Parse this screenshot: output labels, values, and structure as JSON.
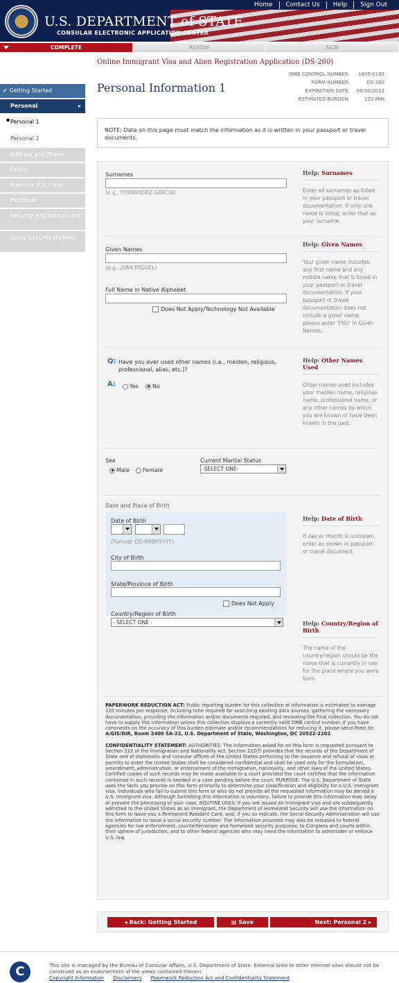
{
  "header": {
    "title": "U.S. DEPARTMENT of STATE",
    "subtitle": "CONSULAR ELECTRONIC APPLICATION CENTER",
    "nav": [
      "Home",
      "Contact Us",
      "Help",
      "Sign Out"
    ]
  },
  "progress": {
    "steps": [
      "COMPLETE",
      "REVIEW",
      "SIGN"
    ]
  },
  "page": {
    "form_title": "Online Immigrant Visa and Alien Registration Application (DS-260)",
    "title": "Personal Information 1"
  },
  "omb": {
    "control_label": "OMB CONTROL NUMBER:",
    "control": "1405-0185",
    "form_label": "FORM NUMBER:",
    "form": "DS-260",
    "exp_label": "EXPIRATION DATE:",
    "exp": "06/30/2012",
    "burden_label": "ESTIMATED BURDEN:",
    "burden": "120 MIN"
  },
  "sidebar": {
    "items": [
      "Getting Started",
      "Personal",
      "Personal 1",
      "Personal 2",
      "Address and Phone",
      "Family",
      "Previous U.S. Travel",
      "Petitioner",
      "Security and Background",
      "Social Security Number"
    ]
  },
  "note": "NOTE: Data on this page must match the information as it is written in your passport or travel documents.",
  "form": {
    "surnames_label": "Surnames",
    "surnames_hint": "(e.g., FERNANDEZ GARCIA)",
    "given_label": "Given Names",
    "given_hint": "(e.g., JUAN MIGUEL)",
    "native_label": "Full Name in Native Alphabet",
    "native_na": "Does Not Apply/Technology Not Available",
    "q_label": "Q:",
    "question": "Have you ever used other names (i.e., maiden, religious, professional, alias, etc.)?",
    "a_label": "A:",
    "yes": "Yes",
    "no": "No",
    "sex_label": "Sex",
    "male": "Male",
    "female": "Female",
    "marital_label": "Current Marital Status",
    "marital_value": "-SELECT ONE-",
    "dob_section": "Date and Place of Birth",
    "dob_label": "Date of Birth",
    "dob_hint": "(Format: DD-MMM-YYYY)",
    "city_label": "City of Birth",
    "state_label": "State/Province of Birth",
    "state_na": "Does Not Apply",
    "country_label": "Country/Region of Birth",
    "country_value": "- SELECT ONE -"
  },
  "help": {
    "surnames_title": "Surnames",
    "surnames": "Enter all surnames as listed in your passport or travel documentation. If only one name is listed, enter that as your surname.",
    "given_title": "Given Names",
    "given": "Your given name includes any first name and any middle name that is listed in your passport or travel documentation. If your passport or travel documentation does not include a given name, please enter 'FNU' in Given Names.",
    "other_title": "Other Names Used",
    "other": "Other names used includes your maiden name, religious name, professional name, or any other names by which you are known or have been known in the past.",
    "dob_title": "Date of Birth",
    "dob": "If day or month is unknown, enter as shown in passport or travel document.",
    "country_title": "Country/Region of Birth",
    "country": "The name of the country/region should be the name that is currently in use for the place where you were born.",
    "prefix": "Help:"
  },
  "legal": {
    "pra_head": "PAPERWORK REDUCTION ACT:",
    "pra": " Public reporting burden for this collection of information is estimated to average 120 minutes per response, including time required for searching existing data sources, gathering the necessary documentation, providing the information and/or documents required, and reviewing the final collection. You do not have to supply this information unless this collection displays a currently valid OMB control number. If you have comments on the accuracy of this burden estimate and/or recommendations for reducing it, please send them to: ",
    "pra_addr": "A/GIS/DIR, Room 2400 SA-22, U.S. Department of State, Washington, DC 20522-2202",
    "conf_head": "CONFIDENTIALITY STATEMENT:",
    "conf": " AUTHORITIES: The information asked for on this form is requested pursuant to Section 222 of the Immigration and Nationality Act. Section 222(f) provides that the records of the Department of State and of diplomatic and consular offices of the United States pertaining to the issuance and refusal of visas or permits to enter the United States shall be considered confidential and shall be used only for the formulation, amendment, administration, or enforcement of the immigration, nationality, and other laws of the United States. Certified copies of such records may be made available to a court provided the court certifies that the information contained in such records is needed in a case pending before the court. PURPOSE: The U.S. Department of State uses the facts you provide on this form primarily to determine your classification and eligibility for a U.S. immigrant visa. Individuals who fail to submit this form or who do not provide all the requested information may be denied a U.S. immigrant visa. Although furnishing this information is voluntary, failure to provide this information may delay or prevent the processing of your case. ROUTINE USES: If you are issued an immigrant visa and are subsequently admitted to the United States as an immigrant, the Department of Homeland Security will use the information on this form to issue you a Permanent Resident Card, and, if you so indicate, the Social Security Administration will use the information to issue a social security number. The information provided may also be released to federal agencies for law enforcement, counterterrorism and homeland security purposes; to Congress and courts within their sphere of jurisdiction; and to other federal agencies who may need the information to administer or enforce U.S. law."
  },
  "buttons": {
    "back": "◂ Back: Getting Started",
    "save": "Save",
    "next": "Next: Personal 2 ▸"
  },
  "footer": {
    "text": "This site is managed by the Bureau of Consular Affairs, U.S. Department of State. External links to other Internet sites should not be construed as an endorsement of the views contained therein.",
    "links": [
      "Copyright Information",
      "Disclaimers",
      "Paperwork Reduction Act and Confidentiality Statement"
    ]
  }
}
